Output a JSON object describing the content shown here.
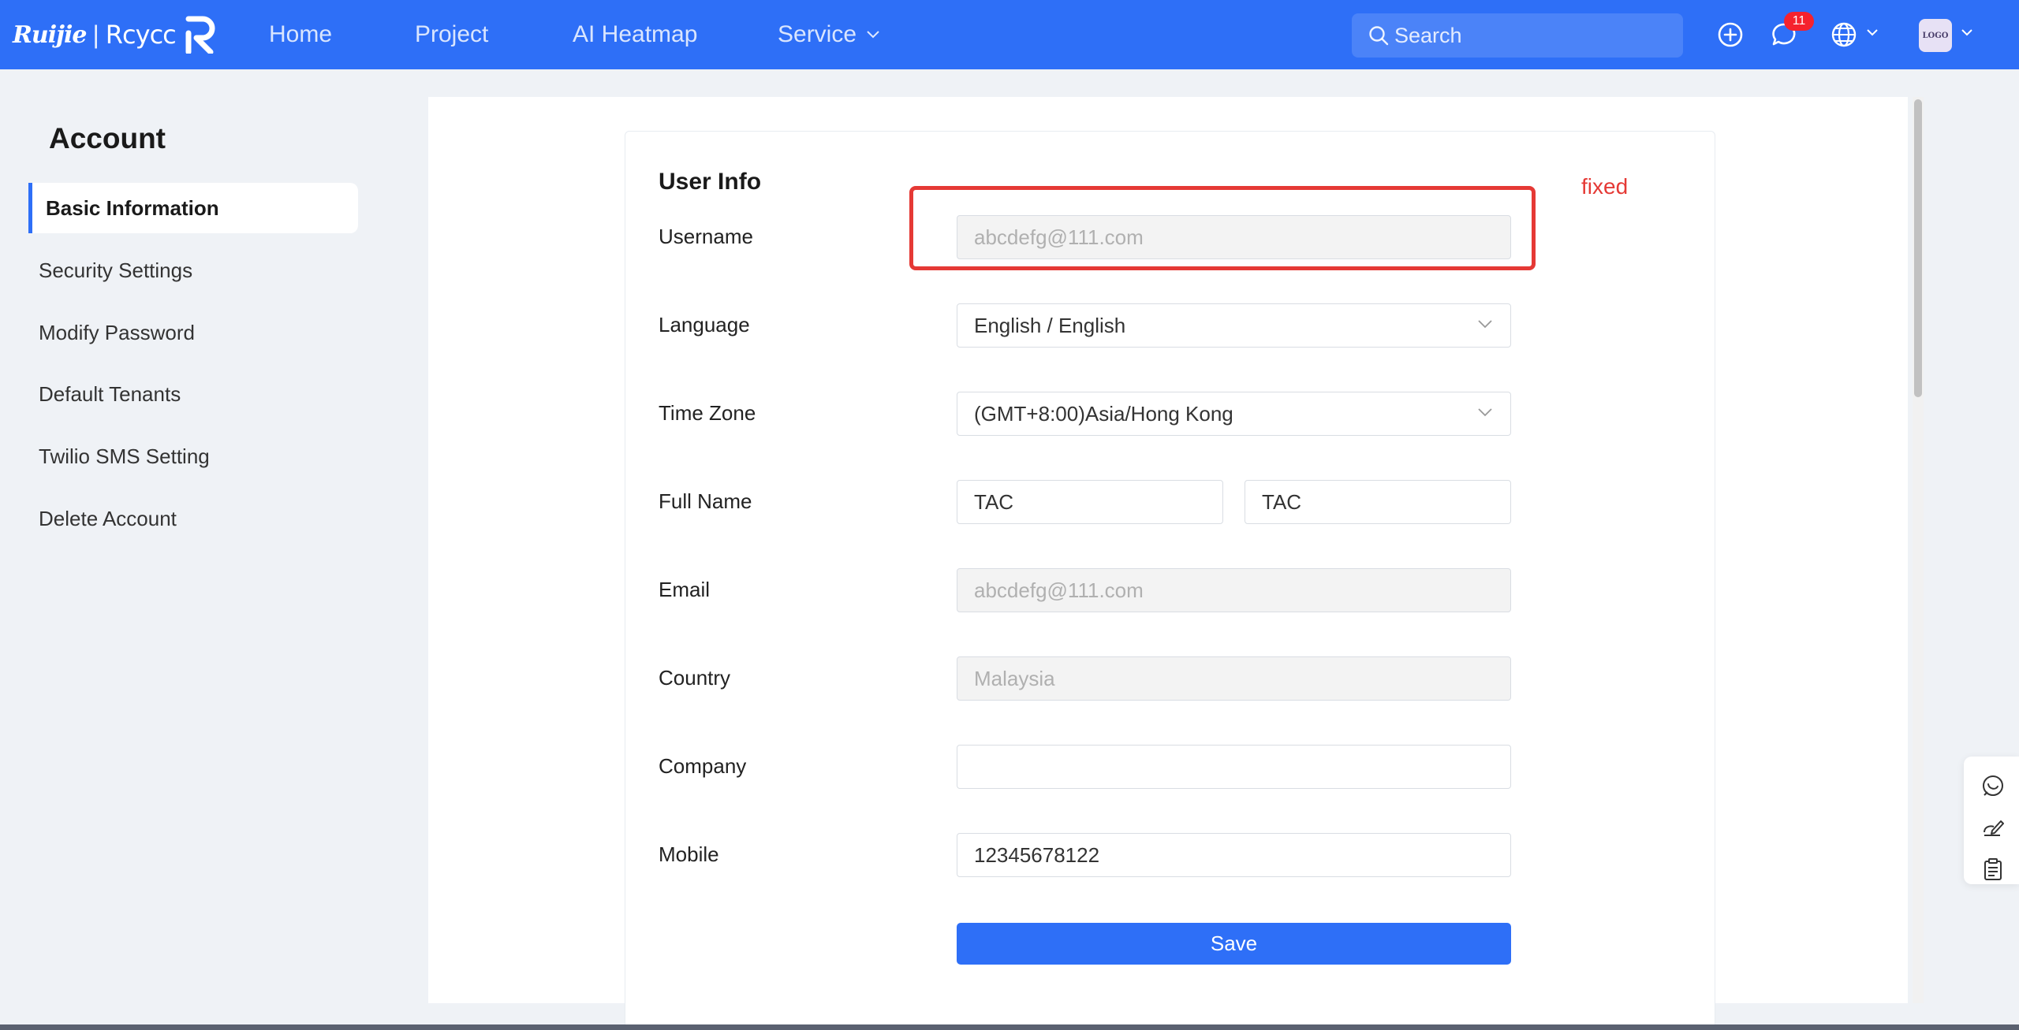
{
  "header": {
    "logo_brand1": "Ruijie",
    "logo_sep": "|",
    "logo_brand2": "Rcycc",
    "nav": {
      "home": "Home",
      "project": "Project",
      "heatmap": "AI Heatmap",
      "service": "Service"
    },
    "search_placeholder": "Search",
    "message_badge": "11",
    "avatar_text": "LOGO"
  },
  "sidebar": {
    "title": "Account",
    "items": [
      {
        "label": "Basic Information",
        "active": true
      },
      {
        "label": "Security Settings"
      },
      {
        "label": "Modify Password"
      },
      {
        "label": "Default Tenants"
      },
      {
        "label": "Twilio SMS Setting"
      },
      {
        "label": "Delete Account"
      }
    ]
  },
  "form": {
    "title": "User Info",
    "username": {
      "label": "Username",
      "value": "abcdefg@111.com"
    },
    "language": {
      "label": "Language",
      "value": "English / English"
    },
    "timezone": {
      "label": "Time Zone",
      "value": "(GMT+8:00)Asia/Hong Kong"
    },
    "fullname": {
      "label": "Full Name",
      "first": "TAC",
      "last": "TAC"
    },
    "email": {
      "label": "Email",
      "value": "abcdefg@111.com"
    },
    "country": {
      "label": "Country",
      "value": "Malaysia"
    },
    "company": {
      "label": "Company",
      "value": ""
    },
    "mobile": {
      "label": "Mobile",
      "value": "12345678122"
    },
    "save": "Save"
  },
  "annotation": {
    "note": "fixed",
    "color": "#e53935"
  },
  "colors": {
    "primary": "#2e6ff7",
    "badge": "#f5222d"
  }
}
